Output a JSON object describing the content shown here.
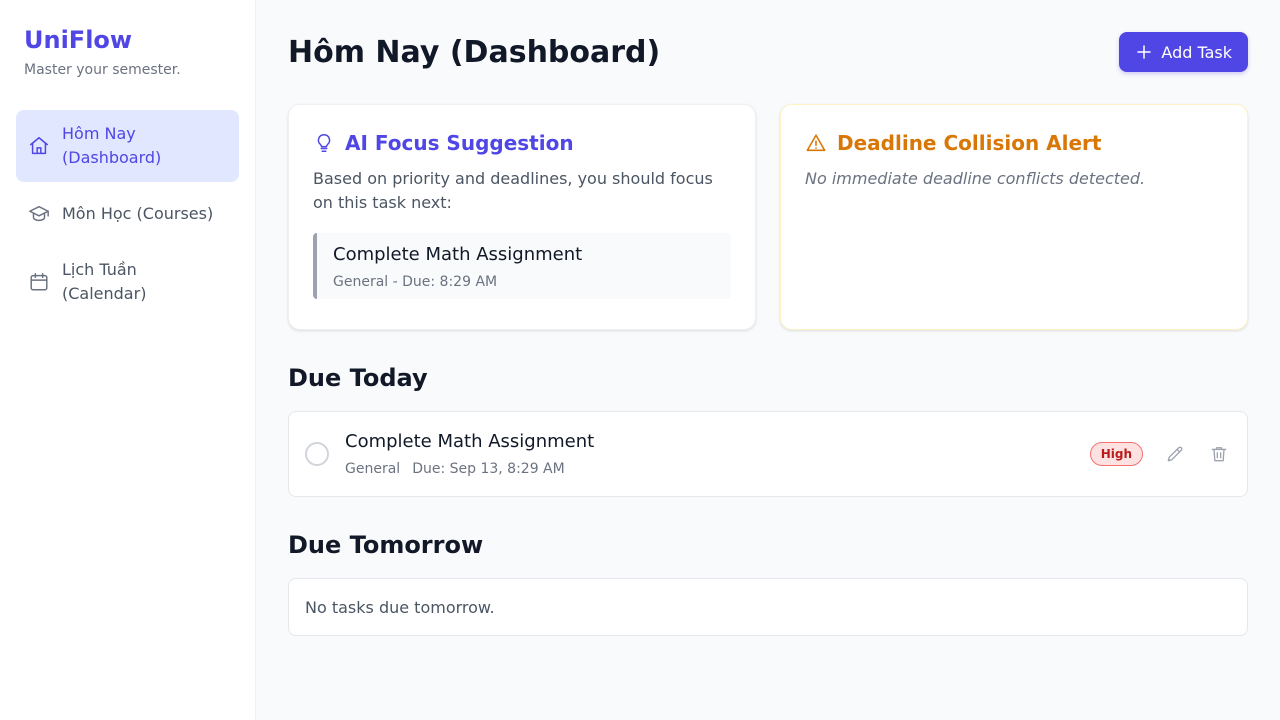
{
  "sidebar": {
    "brand": "UniFlow",
    "tagline": "Master your semester.",
    "items": [
      {
        "label": "Hôm Nay\n(Dashboard)",
        "line1": "Hôm Nay",
        "line2": "(Dashboard)",
        "icon": "home-icon",
        "active": true
      },
      {
        "label": "Môn Học (Courses)",
        "icon": "graduation-cap-icon",
        "active": false
      },
      {
        "label": "Lịch Tuần (Calendar)",
        "line1": "Lịch Tuần",
        "line2": "(Calendar)",
        "icon": "calendar-icon",
        "active": false
      }
    ]
  },
  "header": {
    "title": "Hôm Nay (Dashboard)",
    "add_button": "Add Task"
  },
  "ai_card": {
    "title": "AI Focus Suggestion",
    "description": "Based on priority and deadlines, you should focus on this task next:",
    "task_title": "Complete Math Assignment",
    "task_meta": "General - Due: 8:29 AM",
    "icon": "lightbulb-icon"
  },
  "alert_card": {
    "title": "Deadline Collision Alert",
    "message": "No immediate deadline conflicts detected.",
    "icon": "warning-icon"
  },
  "due_today": {
    "title": "Due Today",
    "tasks": [
      {
        "title": "Complete Math Assignment",
        "course": "General",
        "due": "Due: Sep 13, 8:29 AM",
        "priority": "High"
      }
    ]
  },
  "due_tomorrow": {
    "title": "Due Tomorrow",
    "empty_message": "No tasks due tomorrow."
  },
  "colors": {
    "accent": "#4f46e5",
    "accent_light": "#e0e7ff",
    "warning": "#d97706",
    "priority_high_bg": "#fee2e2",
    "priority_high_text": "#b91c1c"
  }
}
